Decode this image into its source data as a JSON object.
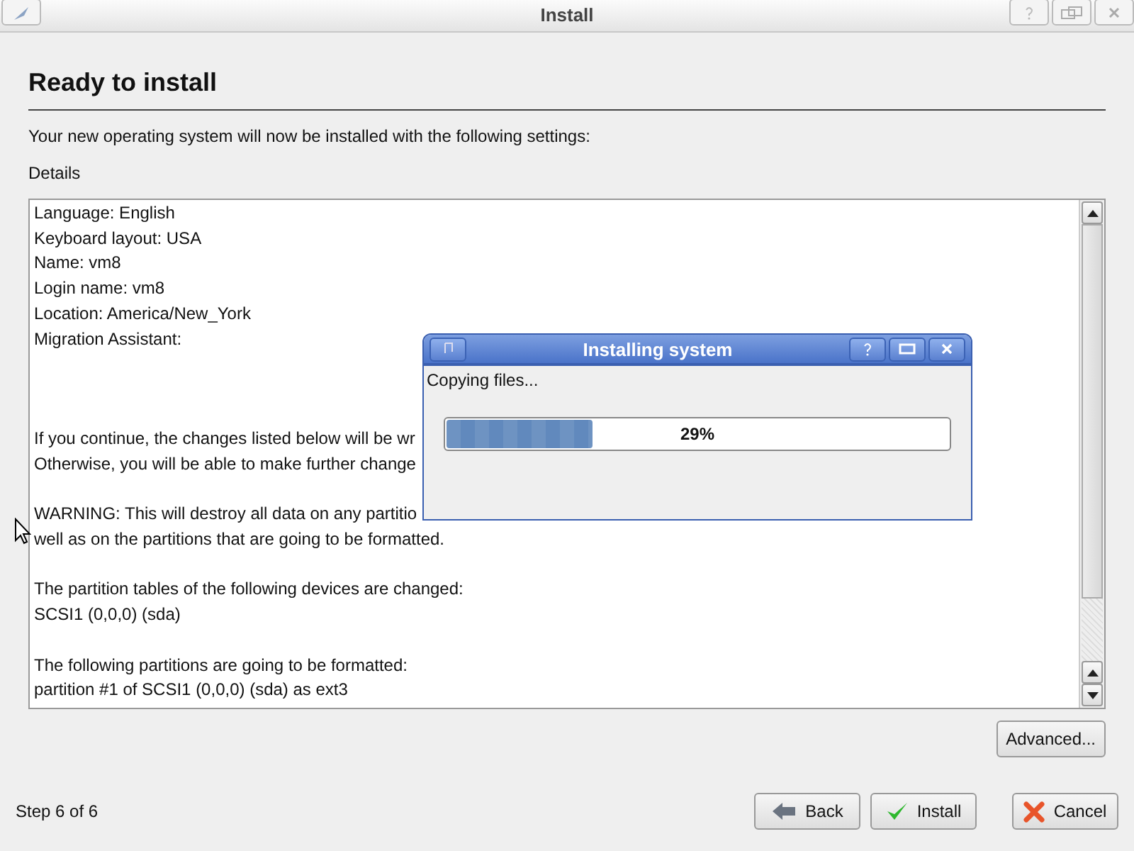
{
  "window": {
    "title": "Install"
  },
  "heading": "Ready to install",
  "intro": "Your new operating system will now be installed with the following settings:",
  "details_label": "Details",
  "details": [
    {
      "kind": "settings",
      "lines": [
        "Language: English",
        "Keyboard layout: USA",
        "Name: vm8",
        "Login name: vm8",
        "Location: America/New_York",
        "Migration Assistant:"
      ]
    },
    {
      "kind": "notice",
      "lines": [
        "If you continue, the changes listed below will be wr",
        "Otherwise, you will be able to make further change"
      ]
    },
    {
      "kind": "notice",
      "lines": [
        "WARNING: This will destroy all data on any partitio",
        "well as on the partitions that are going to be formatted."
      ]
    },
    {
      "kind": "notice",
      "lines": [
        "The partition tables of the following devices are changed:",
        "SCSI1 (0,0,0) (sda)"
      ]
    },
    {
      "kind": "notice",
      "lines": [
        "The following partitions are going to be formatted:",
        "partition #1 of SCSI1 (0,0,0) (sda) as ext3"
      ]
    }
  ],
  "advanced_button": "Advanced...",
  "step": "Step 6 of 6",
  "buttons": [
    {
      "kind": "back",
      "label": "Back"
    },
    {
      "kind": "install",
      "label": "Install"
    },
    {
      "kind": "cancel",
      "label": "Cancel"
    }
  ],
  "progress_dialog": {
    "title": "Installing system",
    "status": "Copying files...",
    "level": 0.29,
    "reading": "29%"
  }
}
